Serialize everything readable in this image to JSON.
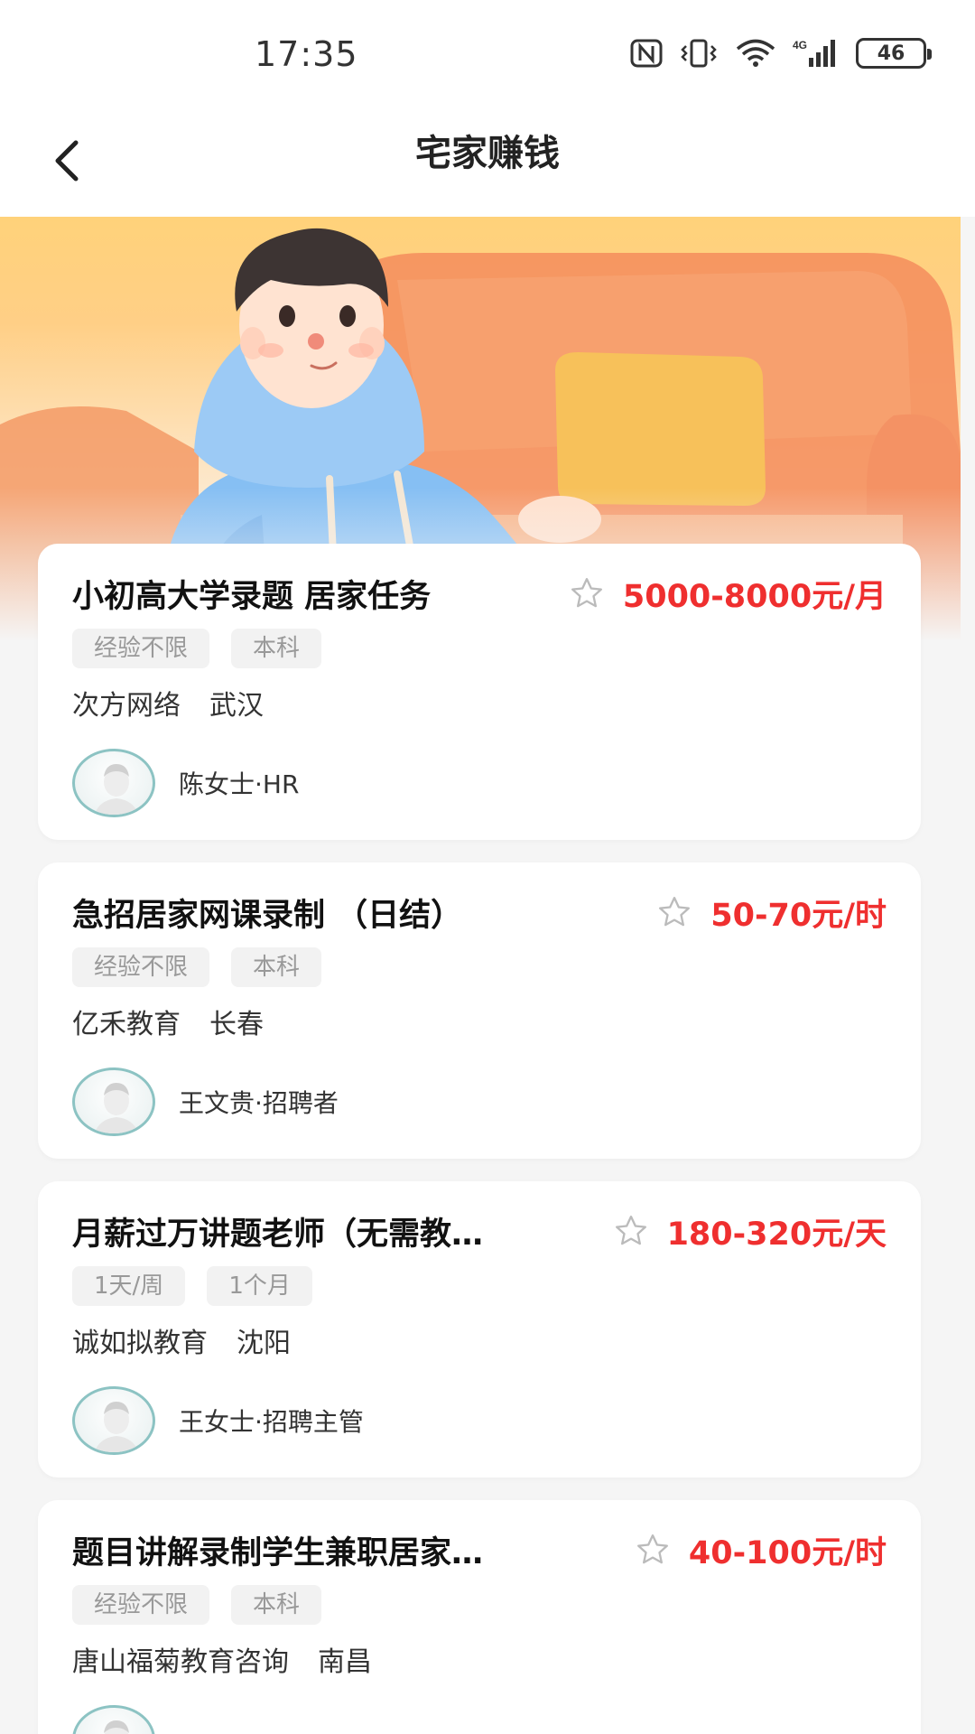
{
  "status_bar": {
    "time": "17:35",
    "network": "4G",
    "battery": "46",
    "icons": [
      "nfc-icon",
      "vibrate-icon",
      "wifi-icon",
      "cellular-signal-icon",
      "battery-icon"
    ]
  },
  "nav": {
    "title": "宅家赚钱",
    "back_icon": "chevron-left-icon"
  },
  "colors": {
    "salary": "#ef2f2f",
    "tag_bg": "#f2f2f2",
    "tag_text": "#999999",
    "page_bg": "#f5f5f5",
    "avatar_border": "#8cc3c3"
  },
  "jobs": [
    {
      "title": "小初高大学录题 居家任务",
      "salary": "5000-8000元/月",
      "tags": [
        "经验不限",
        "本科"
      ],
      "company": "次方网络",
      "city": "武汉",
      "recruiter": "陈女士·HR"
    },
    {
      "title": "急招居家网课录制 （日结）",
      "salary": "50-70元/时",
      "tags": [
        "经验不限",
        "本科"
      ],
      "company": "亿禾教育",
      "city": "长春",
      "recruiter": "王文贵·招聘者"
    },
    {
      "title": "月薪过万讲题老师（无需教…",
      "salary": "180-320元/天",
      "tags": [
        "1天/周",
        "1个月"
      ],
      "company": "诚如拟教育",
      "city": "沈阳",
      "recruiter": "王女士·招聘主管"
    },
    {
      "title": "题目讲解录制学生兼职居家…",
      "salary": "40-100元/时",
      "tags": [
        "经验不限",
        "本科"
      ],
      "company": "唐山福菊教育咨询",
      "city": "南昌",
      "recruiter": ""
    }
  ]
}
